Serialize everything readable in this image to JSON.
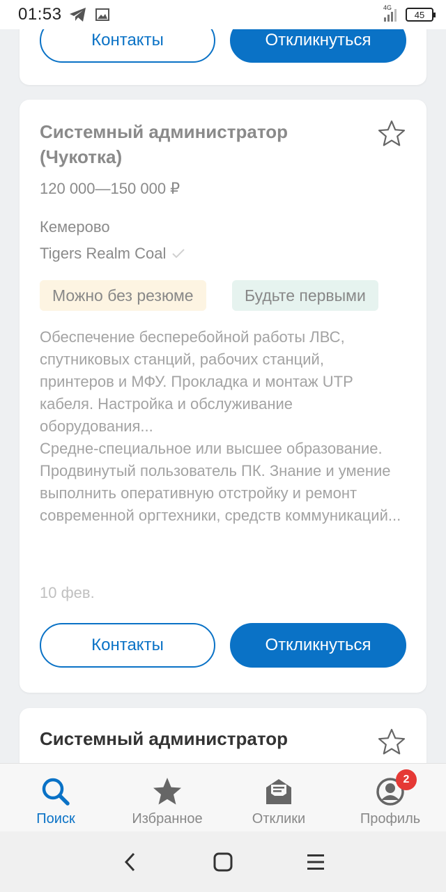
{
  "status": {
    "time": "01:53",
    "network": "4G",
    "battery": "45"
  },
  "top_card": {
    "contacts_label": "Контакты",
    "respond_label": "Откликнуться"
  },
  "vacancy": {
    "title": "Системный администратор (Чукотка)",
    "salary": "120 000—150 000 ₽",
    "city": "Кемерово",
    "company": "Tigers Realm Coal",
    "tags": [
      "Можно без резюме",
      "Будьте первыми"
    ],
    "description_1": "Обеспечение бесперебойной работы ЛВС, спутниковых станций, рабочих станций, принтеров и МФУ. Прокладка и монтаж UTP кабеля. Настройка и обслуживание оборудования...",
    "description_2": "Средне-специальное или высшее образование. Продвинутый пользователь ПК. Знание и умение выполнить оперативную отстройку и ремонт современной оргтехники, средств коммуникаций...",
    "date": "10 фев.",
    "contacts_label": "Контакты",
    "respond_label": "Откликнуться"
  },
  "next_vacancy": {
    "title": "Системный администратор"
  },
  "bottom_nav": {
    "items": [
      {
        "label": "Поиск",
        "icon": "search-icon"
      },
      {
        "label": "Избранное",
        "icon": "star-icon"
      },
      {
        "label": "Отклики",
        "icon": "envelope-icon"
      },
      {
        "label": "Профиль",
        "icon": "profile-icon"
      }
    ],
    "profile_badge": "2"
  },
  "colors": {
    "accent": "#0a72c6",
    "badge": "#e53935",
    "tag_yellow": "#fdf4e2",
    "tag_green": "#e6f3ef"
  }
}
